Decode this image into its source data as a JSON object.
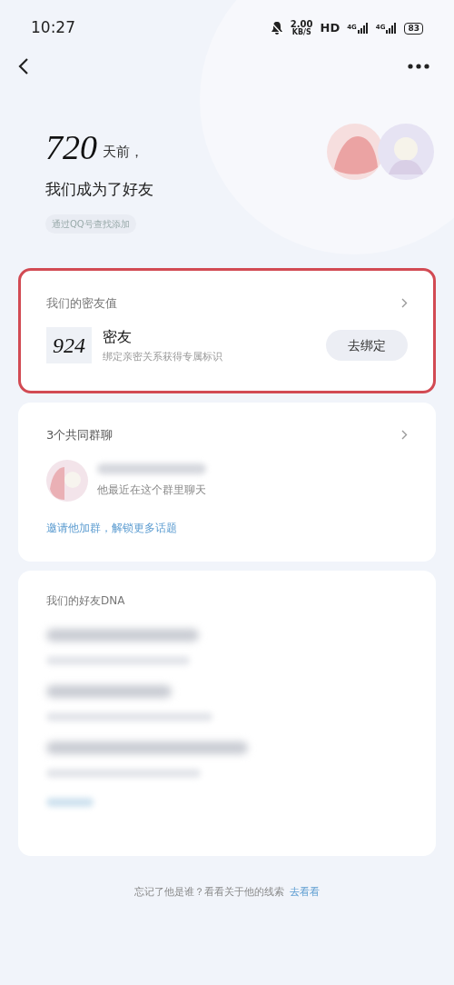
{
  "status_bar": {
    "time": "10:27",
    "speed_value": "2.00",
    "speed_unit": "KB/S",
    "hd": "HD",
    "network_1": "4G",
    "network_2": "4G",
    "battery": "83"
  },
  "header": {
    "days": "720",
    "days_suffix": "天前，",
    "subtitle": "我们成为了好友",
    "source_chip": "通过QQ号查找添加"
  },
  "intimacy_card": {
    "title": "我们的密友值",
    "score": "924",
    "level_name": "密友",
    "hint": "绑定亲密关系获得专属标识",
    "button": "去绑定",
    "highlighted": true
  },
  "groups_card": {
    "title": "3个共同群聊",
    "group_hint": "他最近在这个群里聊天",
    "invite_link": "邀请他加群，解锁更多话题"
  },
  "dna_card": {
    "title": "我们的好友DNA"
  },
  "footer": {
    "text": "忘记了他是谁？看看关于他的线索",
    "link": "去看看"
  }
}
